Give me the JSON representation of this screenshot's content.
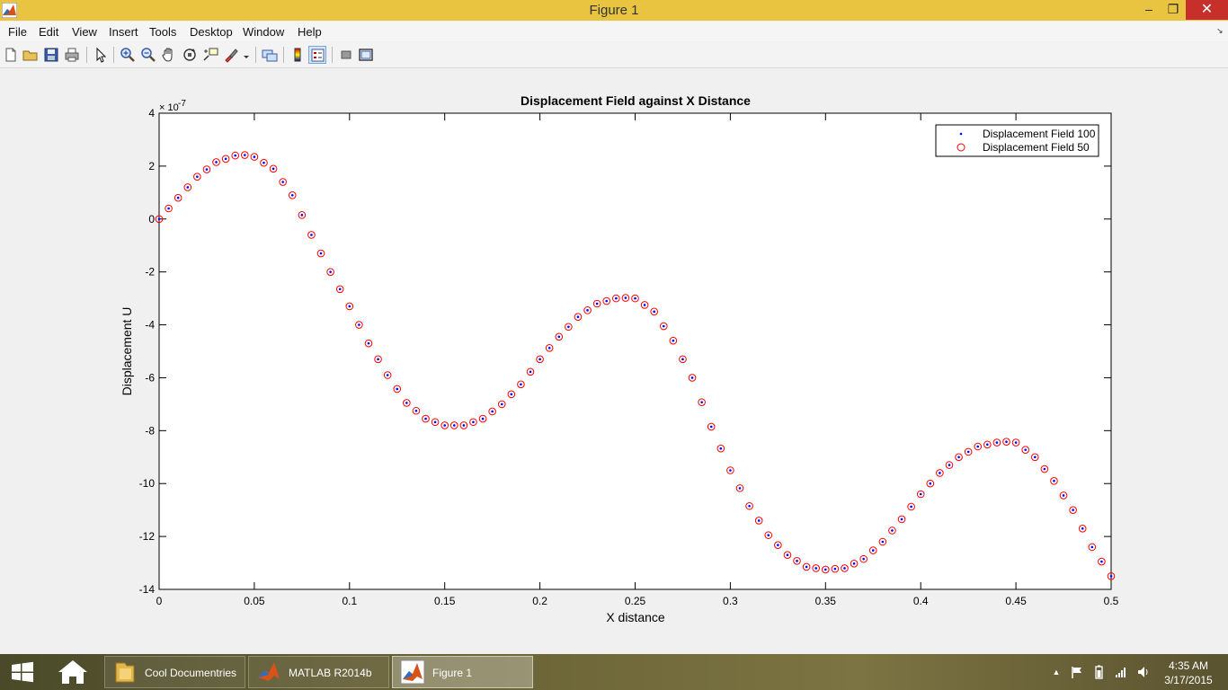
{
  "window": {
    "title": "Figure 1"
  },
  "controls": {
    "minimize": "–",
    "maximize": "❐",
    "close": "✕"
  },
  "menu": [
    "File",
    "Edit",
    "View",
    "Insert",
    "Tools",
    "Desktop",
    "Window",
    "Help"
  ],
  "toolbar": [
    "new-figure-icon",
    "open-file-icon",
    "save-icon",
    "print-icon",
    "edit-plot-icon",
    "zoom-in-icon",
    "zoom-out-icon",
    "pan-icon",
    "rotate-3d-icon",
    "data-cursor-icon",
    "brush-icon",
    "link-plot-icon",
    "insert-colorbar-icon",
    "insert-legend-icon",
    "hide-plot-tools-icon",
    "show-plot-tools-icon"
  ],
  "chart_data": {
    "type": "scatter",
    "title": "Displacement Field against X Distance",
    "xlabel": "X distance",
    "ylabel": "Displacement U",
    "exponent_label": "× 10",
    "exponent_power": "-7",
    "xlim": [
      0,
      0.5
    ],
    "ylim": [
      -14,
      4
    ],
    "y_scale": "1e-7",
    "xticks": [
      "0",
      "0.05",
      "0.1",
      "0.15",
      "0.2",
      "0.25",
      "0.3",
      "0.35",
      "0.4",
      "0.45",
      "0.5"
    ],
    "yticks": [
      "4",
      "2",
      "0",
      "-2",
      "-4",
      "-6",
      "-8",
      "-10",
      "-12",
      "-14"
    ],
    "legend_position": "top-right",
    "grid": false,
    "series": [
      {
        "name": "Displacement Field 100",
        "marker": "dot",
        "color": "#0000ff",
        "x_start": 0,
        "x_step": 0.005,
        "count": 101
      },
      {
        "name": "Displacement Field 50",
        "marker": "circle",
        "color": "#ff0000",
        "x_start": 0,
        "x_step": 0.005,
        "count": 101
      }
    ],
    "curve_keypoints": {
      "x": [
        0,
        0.01,
        0.02,
        0.03,
        0.04,
        0.045,
        0.05,
        0.06,
        0.07,
        0.08,
        0.09,
        0.1,
        0.11,
        0.12,
        0.13,
        0.14,
        0.15,
        0.16,
        0.17,
        0.18,
        0.19,
        0.2,
        0.21,
        0.22,
        0.23,
        0.24,
        0.245,
        0.25,
        0.26,
        0.27,
        0.28,
        0.29,
        0.3,
        0.31,
        0.32,
        0.33,
        0.34,
        0.35,
        0.36,
        0.37,
        0.38,
        0.39,
        0.4,
        0.41,
        0.42,
        0.43,
        0.44,
        0.445,
        0.45,
        0.46,
        0.47,
        0.48,
        0.49,
        0.5
      ],
      "y": [
        0,
        0.8,
        1.6,
        2.15,
        2.4,
        2.42,
        2.35,
        1.9,
        0.9,
        -0.6,
        -2.0,
        -3.3,
        -4.7,
        -5.9,
        -6.95,
        -7.55,
        -7.8,
        -7.8,
        -7.55,
        -7.0,
        -6.25,
        -5.3,
        -4.45,
        -3.7,
        -3.2,
        -3.0,
        -2.98,
        -3.0,
        -3.5,
        -4.6,
        -6.0,
        -7.85,
        -9.5,
        -10.85,
        -11.95,
        -12.7,
        -13.15,
        -13.25,
        -13.2,
        -12.85,
        -12.2,
        -11.35,
        -10.4,
        -9.6,
        -9.0,
        -8.6,
        -8.45,
        -8.42,
        -8.45,
        -9.0,
        -9.9,
        -11.0,
        -12.4,
        -13.5
      ]
    }
  },
  "taskbar": {
    "apps": [
      {
        "label": "Cool Documentries",
        "icon": "folder-icon"
      },
      {
        "label": "MATLAB R2014b",
        "icon": "matlab-icon"
      },
      {
        "label": "Figure 1",
        "icon": "matlab-figure-icon"
      }
    ],
    "clock_time": "4:35 AM",
    "clock_date": "3/17/2015"
  }
}
